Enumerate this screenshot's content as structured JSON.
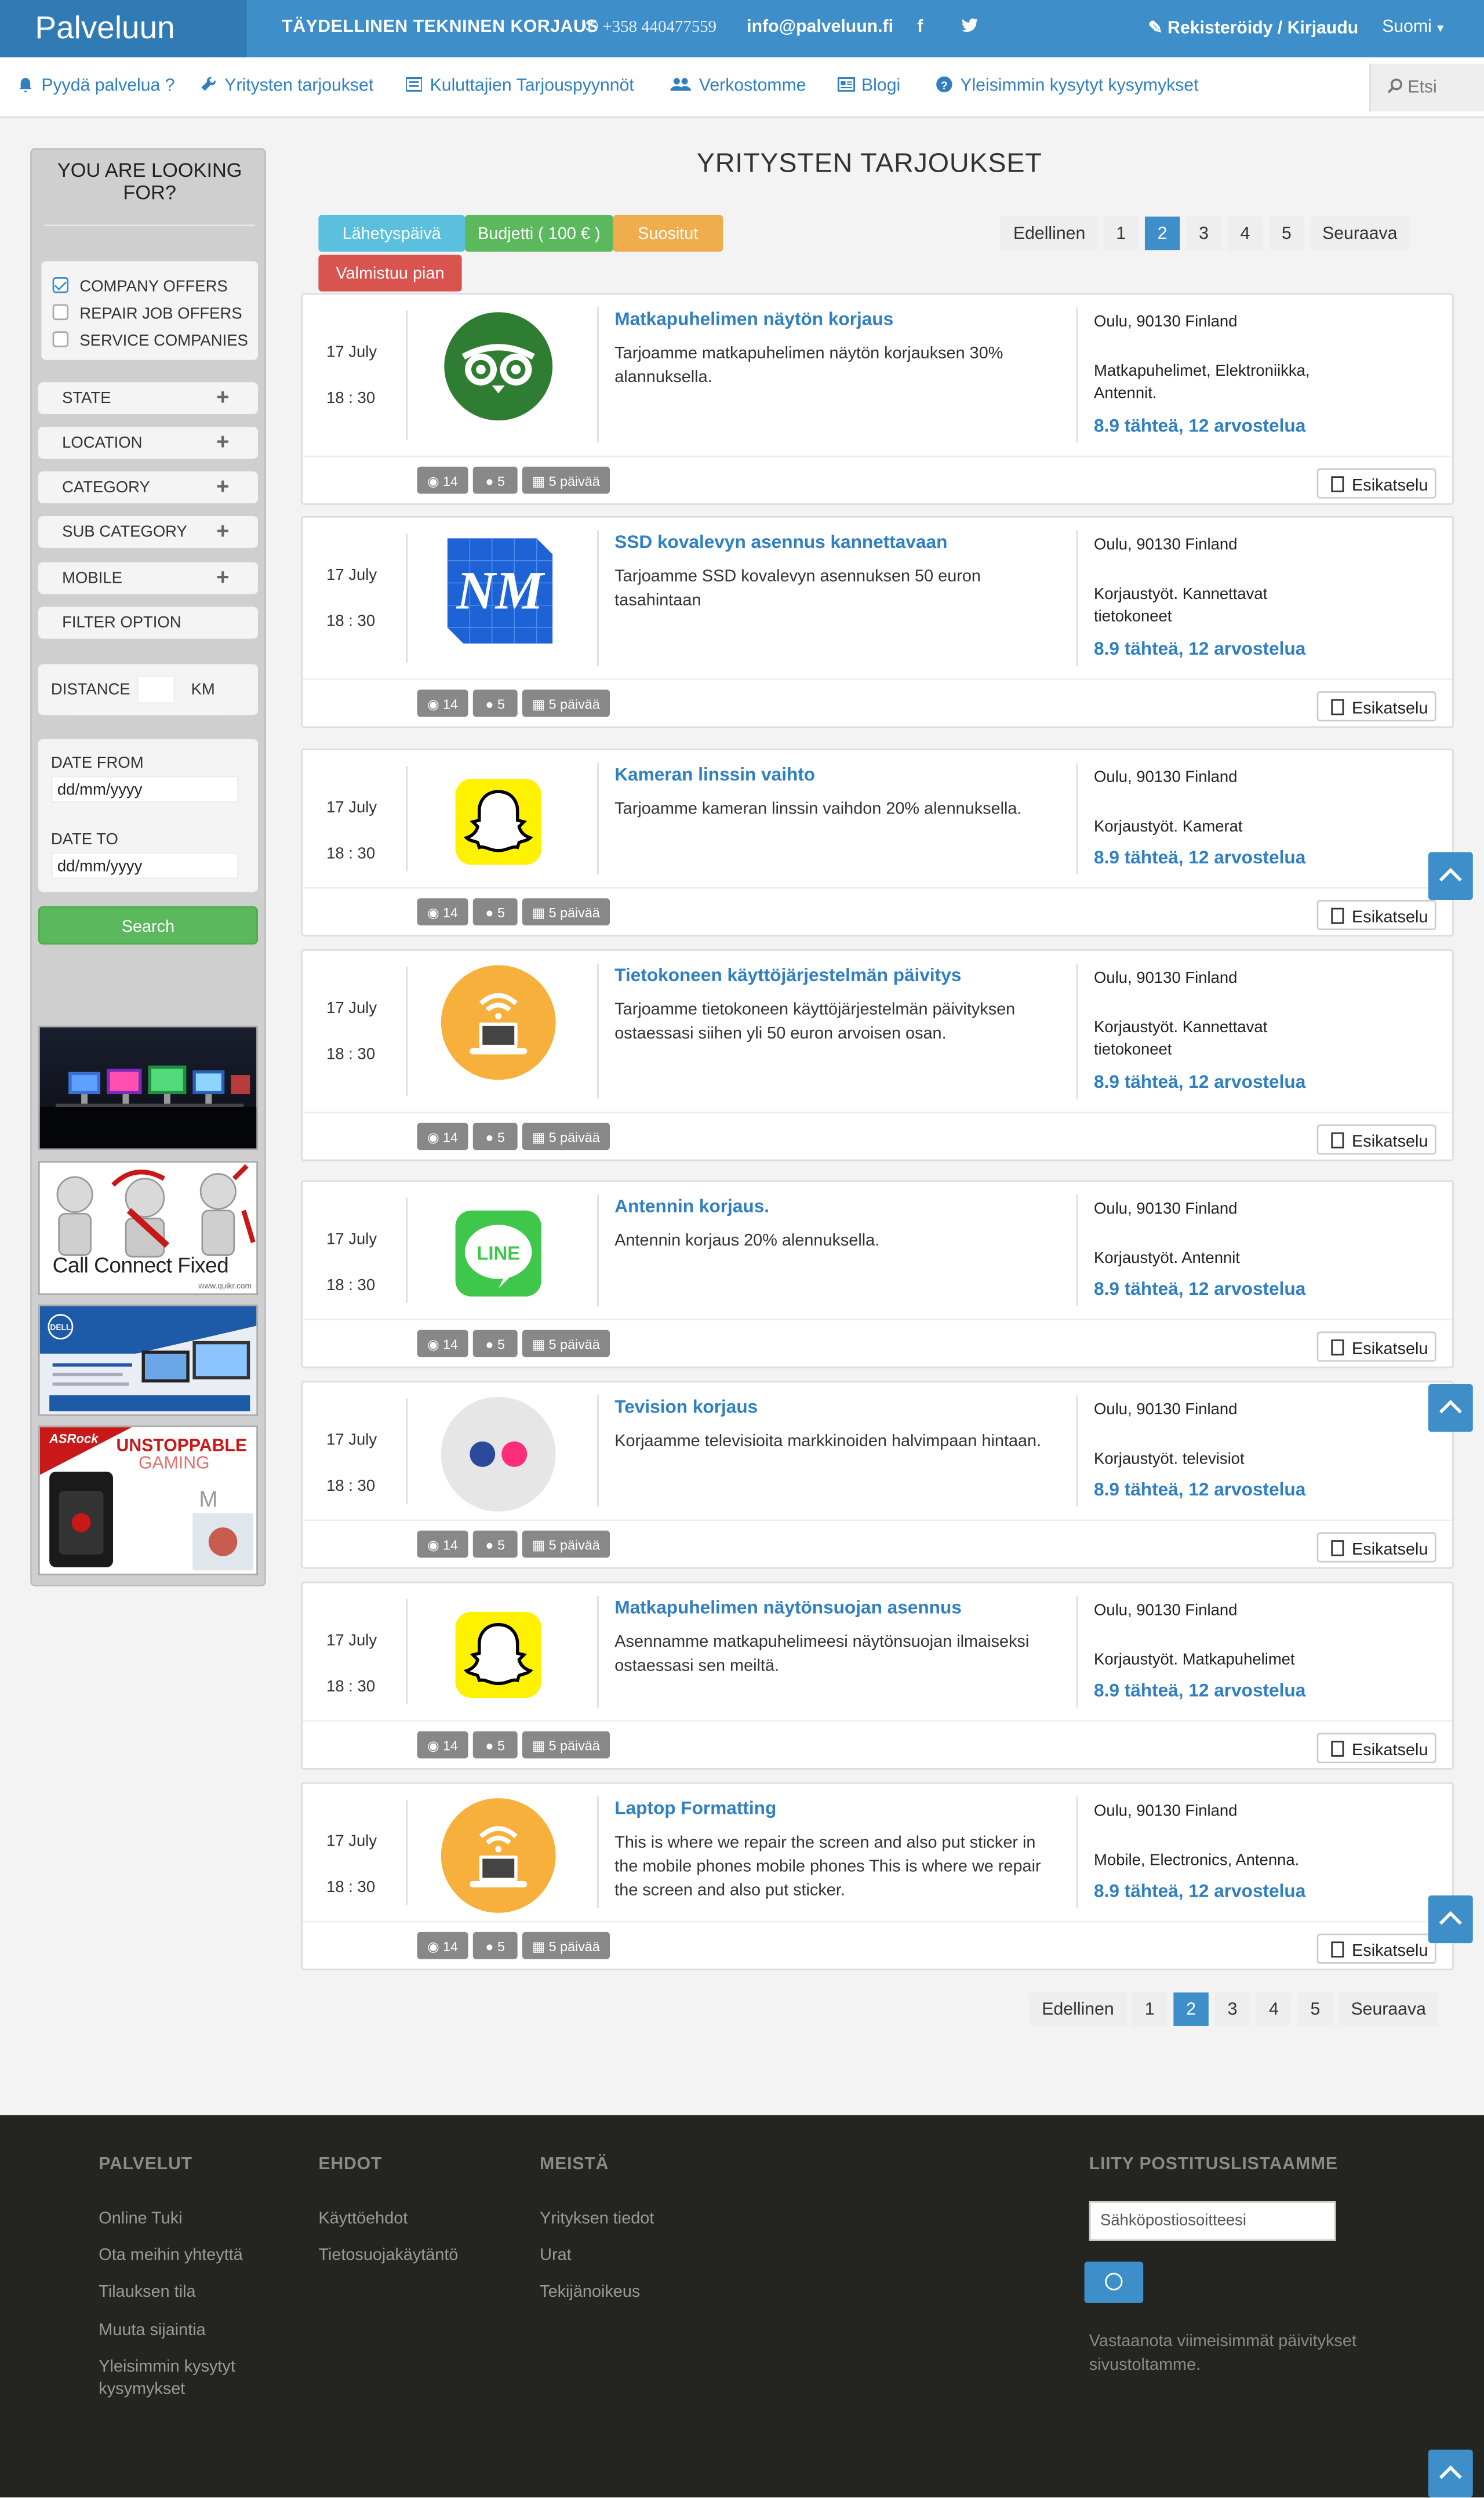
{
  "topbar": {
    "brand": "Palveluun",
    "tagline": "TÄYDELLINEN TEKNINEN KORJAUS",
    "phone": "+358 440477559",
    "email": "info@palveluun.fi",
    "social_icons": [
      "facebook-icon",
      "twitter-icon"
    ],
    "register_login": "Rekisteröidy / Kirjaudu",
    "language": "Suomi"
  },
  "nav": {
    "items": [
      {
        "label": "Pyydä palvelua ?",
        "icon": "bell-icon"
      },
      {
        "label": "Yritysten tarjoukset",
        "icon": "wrench-icon"
      },
      {
        "label": "Kuluttajien Tarjouspyynnöt",
        "icon": "list-icon"
      },
      {
        "label": "Verkostomme",
        "icon": "users-icon"
      },
      {
        "label": "Blogi",
        "icon": "newspaper-icon"
      },
      {
        "label": "Yleisimmin kysytyt kysymykset",
        "icon": "question-icon"
      }
    ],
    "search_placeholder": "Etsi"
  },
  "sidebar": {
    "title_line1": "YOU ARE LOOKING",
    "title_line2": "FOR?",
    "checks": [
      {
        "label": "COMPANY OFFERS",
        "checked": true
      },
      {
        "label": "REPAIR JOB OFFERS",
        "checked": false
      },
      {
        "label": "SERVICE COMPANIES",
        "checked": false
      }
    ],
    "filters": [
      "STATE",
      "LOCATION",
      "CATEGORY",
      "SUB CATEGORY",
      "MOBILE"
    ],
    "filter_option": "FILTER OPTION",
    "distance_label": "DISTANCE",
    "distance_unit": "KM",
    "date_from_label": "DATE FROM",
    "date_from_value": "dd/mm/yyyy",
    "date_to_label": "DATE TO",
    "date_to_value": "dd/mm/yyyy",
    "search_button": "Search",
    "ads": {
      "call_connect": [
        "Call",
        "Connect",
        "Fixed"
      ],
      "call_connect_url": "www.quikr.com",
      "asrock_brand": "ASRock",
      "asrock_line1": "UNSTOPPABLE",
      "asrock_line2": "GAMING",
      "dell_brand": "DELL"
    }
  },
  "main": {
    "title": "YRITYSTEN TARJOUKSET",
    "filter_buttons": [
      {
        "label": "Lähetyspäivä",
        "color": "#5bc0de"
      },
      {
        "label": "Budjetti ( 100 € )",
        "color": "#5cb85c"
      },
      {
        "label": "Suositut",
        "color": "#f0ad4e"
      },
      {
        "label": "Valmistuu pian",
        "color": "#d9534f"
      }
    ],
    "pagination": {
      "prev": "Edellinen",
      "pages": [
        "1",
        "2",
        "3",
        "4",
        "5"
      ],
      "active": "2",
      "next": "Seuraava"
    },
    "preview_label": "Esikatselu",
    "offers": [
      {
        "date": "17 July",
        "time": "18 : 30",
        "logo": "tripadvisor-owl-icon",
        "title": "Matkapuhelimen näytön korjaus",
        "description": "Tarjoamme matkapuhelimen näytön korjauksen 30% alannuksella.",
        "location": "Oulu, 90130 Finland",
        "category": "Matkapuhelimet, Elektroniikka, Antennit.",
        "rating": "8.9 tähteä, 12 arvostelua",
        "views": "14",
        "users": "5",
        "days": "5 päivää"
      },
      {
        "date": "17 July",
        "time": "18 : 30",
        "logo": "nm-logo-icon",
        "title": "SSD kovalevyn asennus kannettavaan",
        "description": "Tarjoamme SSD kovalevyn asennuksen 50 euron tasahintaan",
        "location": "Oulu, 90130 Finland",
        "category": "Korjaustyöt. Kannettavat tietokoneet",
        "rating": "8.9 tähteä, 12 arvostelua",
        "views": "14",
        "users": "5",
        "days": "5 päivää"
      },
      {
        "date": "17 July",
        "time": "18 : 30",
        "logo": "snapchat-ghost-icon",
        "title": "Kameran linssin vaihto",
        "description": "Tarjoamme kameran linssin vaihdon 20% alennuksella.",
        "location": "Oulu, 90130 Finland",
        "category": "Korjaustyöt. Kamerat",
        "rating": "8.9 tähteä, 12 arvostelua",
        "views": "14",
        "users": "5",
        "days": "5 päivää"
      },
      {
        "date": "17 July",
        "time": "18 : 30",
        "logo": "laptop-wifi-icon",
        "title": "Tietokoneen käyttöjärjestelmän päivitys",
        "description": "Tarjoamme tietokoneen käyttöjärjestelmän päivityksen ostaessasi siihen yli 50 euron arvoisen osan.",
        "location": "Oulu, 90130 Finland",
        "category": "Korjaustyöt. Kannettavat tietokoneet",
        "rating": "8.9 tähteä, 12 arvostelua",
        "views": "14",
        "users": "5",
        "days": "5 päivää"
      },
      {
        "date": "17 July",
        "time": "18 : 30",
        "logo": "line-app-icon",
        "title": "Antennin korjaus.",
        "description": "Antennin korjaus 20% alennuksella.",
        "location": "Oulu, 90130 Finland",
        "category": "Korjaustyöt. Antennit",
        "rating": "8.9 tähteä, 12 arvostelua",
        "views": "14",
        "users": "5",
        "days": "5 päivää"
      },
      {
        "date": "17 July",
        "time": "18 : 30",
        "logo": "flickr-dots-icon",
        "title": "Tevision korjaus",
        "description": "Korjaamme televisioita markkinoiden halvimpaan hintaan.",
        "location": "Oulu, 90130 Finland",
        "category": "Korjaustyöt. televisiot",
        "rating": "8.9 tähteä, 12 arvostelua",
        "views": "14",
        "users": "5",
        "days": "5 päivää"
      },
      {
        "date": "17 July",
        "time": "18 : 30",
        "logo": "snapchat-ghost-icon",
        "title": "Matkapuhelimen näytönsuojan asennus",
        "description": "Asennamme matkapuhelimeesi näytönsuojan ilmaiseksi ostaessasi sen meiltä.",
        "location": "Oulu, 90130 Finland",
        "category": "Korjaustyöt. Matkapuhelimet",
        "rating": "8.9 tähteä, 12 arvostelua",
        "views": "14",
        "users": "5",
        "days": "5 päivää"
      },
      {
        "date": "17 July",
        "time": "18 : 30",
        "logo": "laptop-wifi-icon",
        "title": "Laptop Formatting",
        "description": "This is where we repair the screen and also put sticker in the mobile phones mobile phones This is where we repair the screen and also put sticker.",
        "location": "Oulu, 90130 Finland",
        "category": "Mobile, Electronics, Antenna.",
        "rating": "8.9 tähteä, 12 arvostelua",
        "views": "14",
        "users": "5",
        "days": "5 päivää"
      }
    ]
  },
  "footer": {
    "columns": [
      {
        "heading": "PALVELUT",
        "links": [
          "Online Tuki",
          "Ota meihin yhteyttä",
          "Tilauksen tila",
          "Muuta sijaintia",
          "Yleisimmin kysytyt kysymykset"
        ]
      },
      {
        "heading": "EHDOT",
        "links": [
          "Käyttöehdot",
          "Tietosuojakäytäntö"
        ]
      },
      {
        "heading": "MEISTÄ",
        "links": [
          "Yrityksen tiedot",
          "Urat",
          "Tekijänoikeus"
        ]
      }
    ],
    "newsletter": {
      "heading": "LIITY POSTITUSLISTAAMME",
      "placeholder": "Sähköpostiosoitteesi",
      "text": "Vastaanota viimeisimmät päivitykset sivustoltamme."
    }
  },
  "colors": {
    "primary": "#3d8ec9",
    "brand_dark": "#317bb4",
    "link": "#2f7fc1",
    "footer_bg": "#242421"
  }
}
